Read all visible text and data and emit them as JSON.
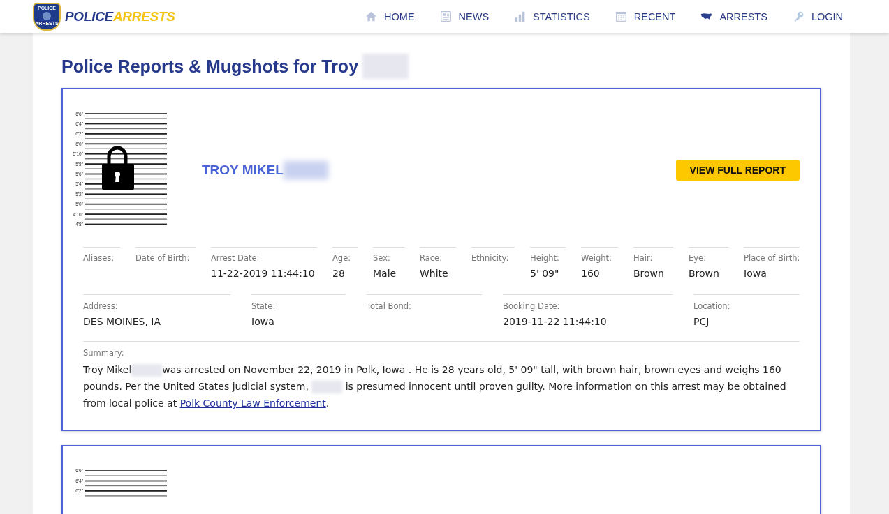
{
  "header": {
    "logo": {
      "part_1": "POLICE",
      "part_2": "ARRESTS",
      "badge_top": "POLICE",
      "badge_bottom": "ARRESTS"
    },
    "nav": [
      {
        "label": "HOME"
      },
      {
        "label": "NEWS"
      },
      {
        "label": "STATISTICS"
      },
      {
        "label": "RECENT"
      },
      {
        "label": "ARRESTS"
      },
      {
        "label": "LOGIN"
      }
    ]
  },
  "page_title": "Police Reports & Mugshots for Troy",
  "records": [
    {
      "name": "TROY MIKEL",
      "button": "VIEW FULL REPORT",
      "height_marks": [
        "6'6\"",
        "6'4\"",
        "6'2\"",
        "6'0\"",
        "5'10\"",
        "5'8\"",
        "5'6\"",
        "5'4\"",
        "5'2\"",
        "5'0\"",
        "4'10\"",
        "4'8\""
      ],
      "fields_row_1": [
        {
          "label": "Aliases:"
        },
        {
          "label": "Date of Birth:"
        },
        {
          "label": "Arrest Date:",
          "value": "11-22-2019 11:44:10"
        },
        {
          "label": "Age:",
          "value": "28"
        },
        {
          "label": "Sex:",
          "value": "Male"
        },
        {
          "label": "Race:",
          "value": "White"
        },
        {
          "label": "Ethnicity:"
        },
        {
          "label": "Height:",
          "value": "5' 09\""
        },
        {
          "label": "Weight:",
          "value": "160"
        },
        {
          "label": "Hair:",
          "value": "Brown"
        },
        {
          "label": "Eye:",
          "value": "Brown"
        },
        {
          "label": "Place of Birth:",
          "value": "Iowa"
        }
      ],
      "fields_row_2": [
        {
          "label": "Address:",
          "value": "DES MOINES, IA"
        },
        {
          "label": "State:",
          "value": "Iowa"
        },
        {
          "label": "Total Bond:"
        },
        {
          "label": "Booking Date:",
          "value": "2019-11-22 11:44:10"
        },
        {
          "label": "Location:",
          "value": "PCJ"
        }
      ],
      "summary_label": "Summary:",
      "summary": {
        "part_1": "Troy Mikel",
        "part_2": "was arrested on November 22, 2019 in Polk, Iowa . He is 28 years old, 5' 09\" tall, with brown hair, brown eyes and weighs 160 pounds. Per the United States judicial system,",
        "part_3": "is presumed innocent until proven guilty. More information on this arrest may be obtained from local police at",
        "link": "Polk County Law Enforcement",
        "end": "."
      }
    },
    {
      "height_marks": [
        "6'6\"",
        "6'4\"",
        "6'2\""
      ]
    }
  ]
}
